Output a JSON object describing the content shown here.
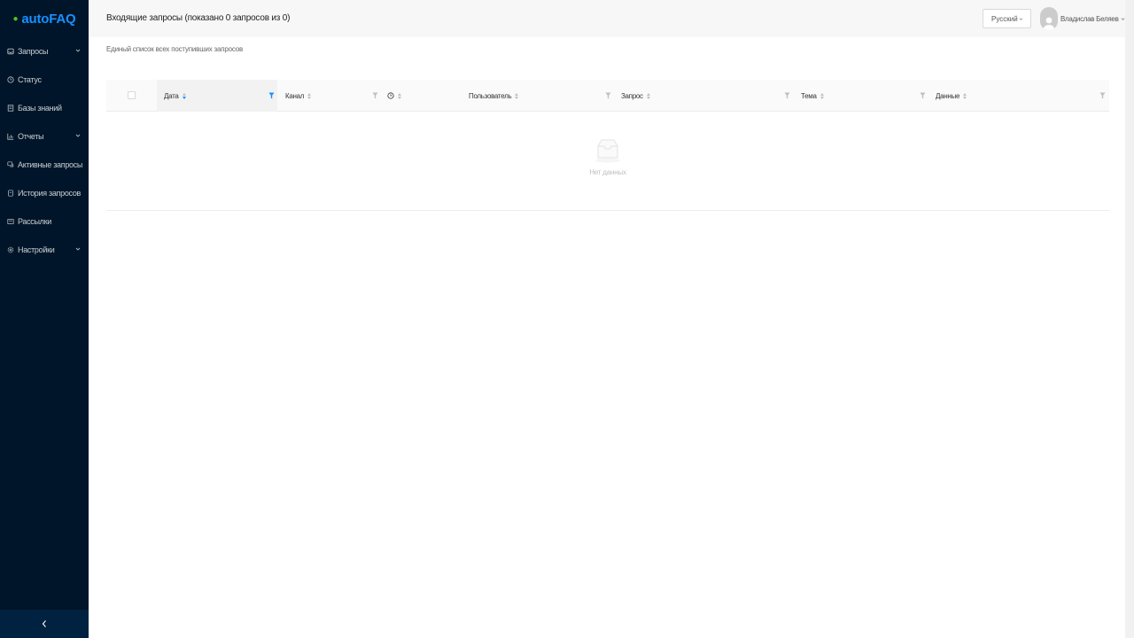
{
  "app": {
    "logo_text": "autoFAQ",
    "brand_color": "#1890ff",
    "sidebar_bg": "#001529"
  },
  "sidebar": {
    "items": [
      {
        "label": "Запросы",
        "icon": "inbox-icon",
        "has_submenu": true
      },
      {
        "label": "Статус",
        "icon": "clock-icon",
        "has_submenu": false
      },
      {
        "label": "Базы знаний",
        "icon": "book-icon",
        "has_submenu": false
      },
      {
        "label": "Отчеты",
        "icon": "bar-chart-icon",
        "has_submenu": true
      },
      {
        "label": "Активные запросы",
        "icon": "chat-icon",
        "has_submenu": false
      },
      {
        "label": "История запросов",
        "icon": "history-icon",
        "has_submenu": false
      },
      {
        "label": "Рассылки",
        "icon": "mail-icon",
        "has_submenu": false
      },
      {
        "label": "Настройки",
        "icon": "gear-icon",
        "has_submenu": true
      }
    ],
    "collapse_icon": "chevron-left-icon"
  },
  "header": {
    "title": "Входящие запросы (показано 0 запросов из 0)",
    "language": "Русский",
    "user_name": "Владислав Беляев"
  },
  "main": {
    "subtitle": "Единый список всех поступивших запросов",
    "table": {
      "columns": [
        {
          "label": "Дата",
          "sorted": "descend",
          "filter_active": true
        },
        {
          "label": "Канал",
          "sorted": null,
          "filter_active": false
        },
        {
          "label": "",
          "icon": "clock-icon",
          "sorted": null
        },
        {
          "label": "Пользователь",
          "sorted": null,
          "filter_active": false
        },
        {
          "label": "Запрос",
          "sorted": null,
          "filter_active": false
        },
        {
          "label": "Тема",
          "sorted": null,
          "filter_active": false
        },
        {
          "label": "Данные",
          "sorted": null,
          "filter_active": false
        }
      ],
      "rows": [],
      "empty_text": "Нет данных"
    }
  }
}
